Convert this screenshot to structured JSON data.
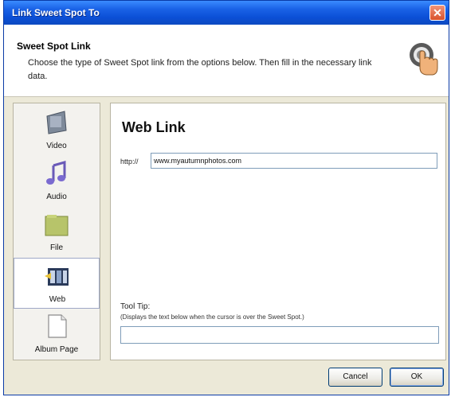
{
  "window": {
    "title": "Link Sweet Spot To",
    "close_label": "✕"
  },
  "header": {
    "title": "Sweet Spot Link",
    "description": "Choose the type of Sweet Spot link from the options below. Then fill in the necessary link data."
  },
  "sidebar": {
    "items": [
      {
        "label": "Video",
        "icon": "video-icon",
        "selected": false
      },
      {
        "label": "Audio",
        "icon": "audio-icon",
        "selected": false
      },
      {
        "label": "File",
        "icon": "folder-icon",
        "selected": false
      },
      {
        "label": "Web",
        "icon": "web-icon",
        "selected": true
      },
      {
        "label": "Album Page",
        "icon": "page-icon",
        "selected": false
      }
    ]
  },
  "panel": {
    "title": "Web Link",
    "url_prefix": "http://",
    "url_value": "www.myautumnphotos.com",
    "tooltip_label": "Tool Tip:",
    "tooltip_desc": "(Displays the text below when the cursor is over the Sweet Spot.)",
    "tooltip_value": ""
  },
  "buttons": {
    "cancel": "Cancel",
    "ok": "OK"
  }
}
